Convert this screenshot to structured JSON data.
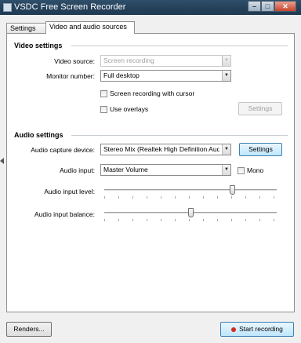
{
  "window": {
    "title": "VSDC Free Screen Recorder"
  },
  "tabs": [
    {
      "label": "Settings"
    },
    {
      "label": "Video and audio sources"
    }
  ],
  "video_settings": {
    "title": "Video settings",
    "video_source_label": "Video source:",
    "video_source_value": "Screen recording",
    "monitor_number_label": "Monitor number:",
    "monitor_number_value": "Full desktop",
    "screen_recording_cursor_label": "Screen recording with cursor",
    "use_overlays_label": "Use overlays",
    "settings_button": "Settings"
  },
  "audio_settings": {
    "title": "Audio settings",
    "capture_device_label": "Audio capture device:",
    "capture_device_value": "Stereo Mix (Realtek High Definition Aud",
    "capture_settings_button": "Settings",
    "audio_input_label": "Audio input:",
    "audio_input_value": "Master Volume",
    "mono_label": "Mono",
    "input_level_label": "Audio input level:",
    "input_level_value": 0.75,
    "input_balance_label": "Audio input balance:",
    "input_balance_value": 0.5
  },
  "footer": {
    "renders_button": "Renders...",
    "start_recording_button": "Start recording"
  },
  "icons": {
    "window": "app-icon",
    "minimize": "minimize-icon",
    "maximize": "maximize-icon",
    "close": "close-icon",
    "record": "record-dot-icon",
    "collapse": "left-arrow-icon"
  }
}
